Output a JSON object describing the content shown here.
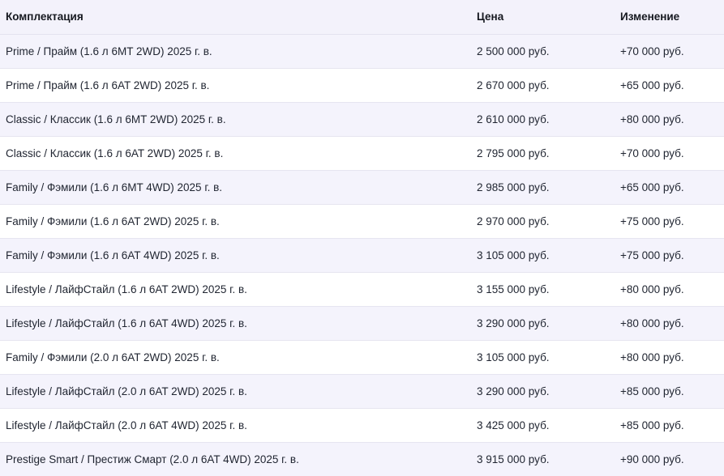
{
  "table": {
    "headers": {
      "config": "Комплектация",
      "price": "Цена",
      "change": "Изменение"
    },
    "rows": [
      {
        "config": "Prime / Прайм (1.6 л 6MT 2WD) 2025 г. в.",
        "price": "2 500 000 руб.",
        "change": "+70 000 руб."
      },
      {
        "config": "Prime / Прайм (1.6 л 6AT 2WD) 2025 г. в.",
        "price": "2 670 000 руб.",
        "change": "+65 000 руб."
      },
      {
        "config": "Classic / Классик (1.6 л 6MT 2WD) 2025 г. в.",
        "price": "2 610 000 руб.",
        "change": "+80 000 руб."
      },
      {
        "config": "Classic / Классик (1.6 л 6AT 2WD) 2025 г. в.",
        "price": "2 795 000 руб.",
        "change": "+70 000 руб."
      },
      {
        "config": "Family / Фэмили (1.6 л 6MT 4WD) 2025 г. в.",
        "price": "2 985 000 руб.",
        "change": "+65 000 руб."
      },
      {
        "config": "Family / Фэмили (1.6 л 6AT 2WD) 2025 г. в.",
        "price": "2 970 000 руб.",
        "change": "+75 000 руб."
      },
      {
        "config": "Family / Фэмили (1.6 л 6AT 4WD) 2025 г. в.",
        "price": "3 105 000 руб.",
        "change": "+75 000 руб."
      },
      {
        "config": "Lifestyle / ЛайфСтайл (1.6 л 6AT 2WD) 2025 г. в.",
        "price": "3 155 000 руб.",
        "change": "+80 000 руб."
      },
      {
        "config": "Lifestyle / ЛайфСтайл (1.6 л 6AT 4WD) 2025 г. в.",
        "price": "3 290 000 руб.",
        "change": "+80 000 руб."
      },
      {
        "config": "Family / Фэмили (2.0 л 6AT 2WD) 2025 г. в.",
        "price": "3 105 000 руб.",
        "change": "+80 000 руб."
      },
      {
        "config": "Lifestyle / ЛайфСтайл (2.0 л 6AT 2WD) 2025 г. в.",
        "price": "3 290 000 руб.",
        "change": "+85 000 руб."
      },
      {
        "config": "Lifestyle / ЛайфСтайл (2.0 л 6AT 4WD) 2025 г. в.",
        "price": "3 425 000 руб.",
        "change": "+85 000 руб."
      },
      {
        "config": "Prestige Smart / Престиж Смарт (2.0 л 6AT 4WD) 2025 г. в.",
        "price": "3 915 000 руб.",
        "change": "+90 000 руб."
      }
    ]
  }
}
